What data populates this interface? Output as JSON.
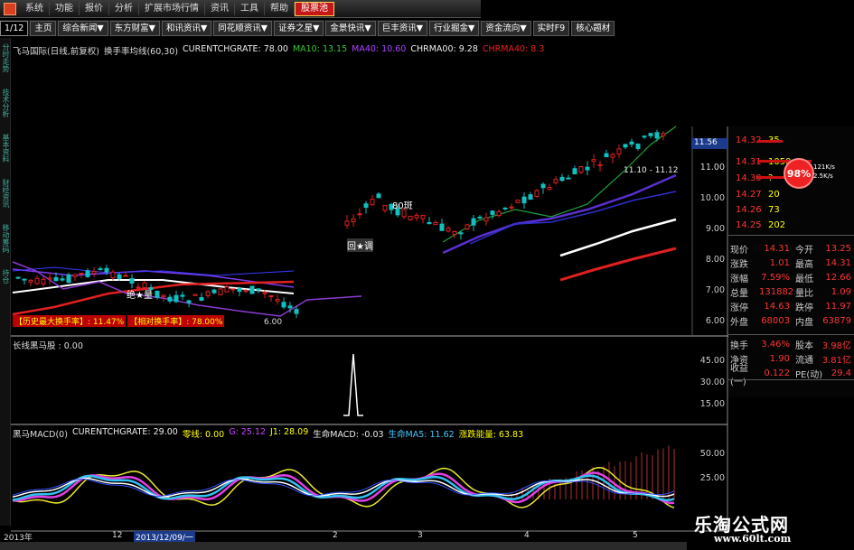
{
  "menu": [
    "系统",
    "功能",
    "报价",
    "分析",
    "扩展市场行情",
    "资讯",
    "工具",
    "帮助",
    "股票池"
  ],
  "menu_active_index": 8,
  "tabs": [
    "1/12",
    "主页",
    "综合新闻▼",
    "东方财富▼",
    "和讯资讯▼",
    "同花顺资讯▼",
    "证券之星▼",
    "金景快讯▼",
    "巨丰资讯▼",
    "行业掘金▼",
    "资金流向▼",
    "实时F9",
    "核心题材"
  ],
  "left_strip": [
    "分时走势",
    "技术分析",
    "基本资料",
    "财经资讯",
    "移动筹码",
    "持仓"
  ],
  "price_panel": {
    "title": "飞马国际(日线,前复权)",
    "indicator": "换手率均线(60,30)",
    "curr": "CURENTCHGRATE: 78.00",
    "ma10": "MA10: 13.15",
    "ma40": "MA40: 10.60",
    "chrma00": "CHRMA00: 9.28",
    "chrma40": "CHRMA40: 8.3",
    "hist_label": "【历史最大换手率】: 11.47%",
    "cur_label": "【相对换手率】: 78.00%",
    "annotations": [
      "80斑",
      "回★调",
      "绝★量",
      "6.00",
      "11.10 - 11.12"
    ],
    "axis": [
      "11.00",
      "10.00",
      "9.00",
      "8.00",
      "7.00",
      "6.00"
    ],
    "selected_price": "11.56"
  },
  "middle_panel": {
    "label": "长线黑马股 : 0.00",
    "axis": [
      "45.00",
      "30.00",
      "15.00"
    ]
  },
  "macd_panel": {
    "title": "黑马MACD(0)",
    "curr": "CURENTCHGRATE: 29.00",
    "zero": "零线: 0.00",
    "g": "G: 25.12",
    "j1": "J1: 28.09",
    "lifemacd": "生命MACD: -0.03",
    "lifema5": "生命MA5: 11.62",
    "energy": "涨跌能量: 63.83",
    "axis": [
      "50.00",
      "25.00"
    ]
  },
  "orderbook": [
    {
      "price": "14.32",
      "vol": "35"
    },
    {
      "price": "14.31",
      "vol": "1050"
    },
    {
      "price": "14.30",
      "vol": "?"
    },
    {
      "price": "14.27",
      "vol": "20"
    },
    {
      "price": "14.26",
      "vol": "73"
    },
    {
      "price": "14.25",
      "vol": "202"
    }
  ],
  "badge": "98%",
  "speed": [
    "121K/s",
    "2.5K/s"
  ],
  "quote": [
    {
      "l1": "现价",
      "v1": "14.31",
      "l2": "今开",
      "v2": "13.25"
    },
    {
      "l1": "涨跌",
      "v1": "1.01",
      "l2": "最高",
      "v2": "14.31"
    },
    {
      "l1": "涨幅",
      "v1": "7.59%",
      "l2": "最低",
      "v2": "12.66"
    },
    {
      "l1": "总量",
      "v1": "131882",
      "l2": "量比",
      "v2": "1.09"
    },
    {
      "l1": "涨停",
      "v1": "14.63",
      "l2": "跌停",
      "v2": "11.97"
    },
    {
      "l1": "外盘",
      "v1": "68003",
      "l2": "内盘",
      "v2": "63879"
    },
    {
      "l1": "换手",
      "v1": "3.46%",
      "l2": "股本",
      "v2": "3.98亿"
    },
    {
      "l1": "净资",
      "v1": "1.90",
      "l2": "流通",
      "v2": "3.81亿"
    },
    {
      "l1": "收益(一)",
      "v1": "0.122",
      "l2": "PE(动)",
      "v2": "29.4"
    }
  ],
  "dates": [
    "2013年",
    "12",
    "2013/12/09/一",
    "2",
    "3",
    "4",
    "5"
  ],
  "watermark": "乐淘公式网",
  "watermark_url": "www.60lt.com"
}
